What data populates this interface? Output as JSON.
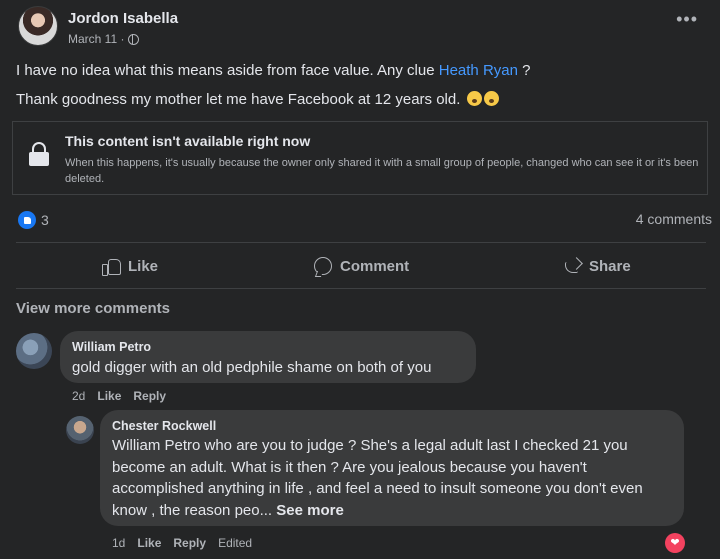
{
  "post": {
    "author": "Jordon Isabella",
    "date": "March 11 ·",
    "text_line1_before": "I have no idea what this means aside from face value. Any clue ",
    "mention": "Heath Ryan",
    "text_line1_after": " ?",
    "text_line2": "Thank goodness my mother let me have Facebook at 12 years old.",
    "more_icon": "•••"
  },
  "unavailable": {
    "title": "This content isn't available right now",
    "description": "When this happens, it's usually because the owner only shared it with a small group of people, changed who can see it or it's been deleted."
  },
  "stats": {
    "reaction_count": "3",
    "comments_count": "4 comments"
  },
  "actions": {
    "like": "Like",
    "comment": "Comment",
    "share": "Share"
  },
  "view_more_comments": "View more comments",
  "comments": [
    {
      "name": "William Petro",
      "text": "gold digger with an old pedphile shame on both of you",
      "time": "2d",
      "like": "Like",
      "reply": "Reply"
    },
    {
      "name": "Chester Rockwell",
      "text": "William Petro who are you to judge ? She's a legal adult last I checked 21 you become an adult. What is it then ? Are you jealous because you haven't accomplished anything in life , and feel a need to insult someone you don't even know , the reason peo... ",
      "see_more": "See more",
      "time": "1d",
      "like": "Like",
      "reply": "Reply",
      "edited": "Edited"
    }
  ],
  "icons": {
    "lock": "lock-icon",
    "globe": "globe-icon",
    "like_reaction": "like-reaction-icon",
    "love_reaction": "heart-icon"
  },
  "colors": {
    "background": "#242526",
    "bubble": "#3a3b3c",
    "link": "#4599ff",
    "like_blue": "#1877f2",
    "love_red": "#f3425f"
  }
}
